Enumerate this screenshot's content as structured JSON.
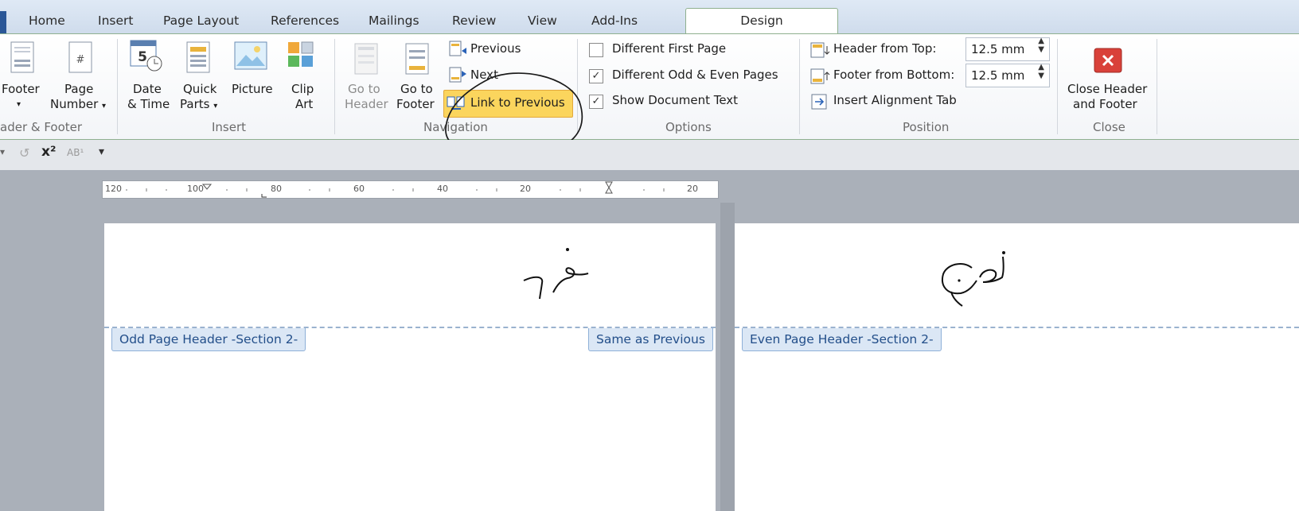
{
  "tabs": [
    "Home",
    "Insert",
    "Page Layout",
    "References",
    "Mailings",
    "Review",
    "View",
    "Add-Ins",
    "Design"
  ],
  "ribbon": {
    "header_footer": {
      "footer": "Footer",
      "page": "Page",
      "number": "Number",
      "group": "ader & Footer"
    },
    "insert": {
      "date": "Date",
      "time": "& Time",
      "quick": "Quick",
      "parts": "Parts",
      "picture": "Picture",
      "clip": "Clip",
      "art": "Art",
      "group": "Insert"
    },
    "navigation": {
      "goto1": "Go to",
      "header": "Header",
      "goto2": "Go to",
      "footer": "Footer",
      "previous": "Previous",
      "next": "Next",
      "link_to_previous": "Link to Previous",
      "group": "Navigation"
    },
    "options": {
      "different_first_page": "Different First Page",
      "different_odd_even": "Different Odd & Even Pages",
      "show_document_text": "Show Document Text",
      "group": "Options",
      "first_checked": false,
      "odd_even_checked": true,
      "show_text_checked": true
    },
    "position": {
      "header_from_top": "Header from Top:",
      "footer_from_bottom": "Footer from Bottom:",
      "header_value": "12.5 mm",
      "footer_value": "12.5 mm",
      "insert_alignment_tab": "Insert Alignment Tab",
      "group": "Position"
    },
    "close": {
      "close1": "Close Header",
      "close2": "and Footer",
      "group": "Close"
    }
  },
  "ruler": {
    "ticks": [
      "120",
      "100",
      "80",
      "60",
      "40",
      "20",
      "20"
    ]
  },
  "pages": {
    "odd_label": "Odd Page Header -Section 2-",
    "same_as_previous": "Same as Previous",
    "even_label": "Even Page Header -Section 2-"
  },
  "colors": {
    "ribbon_border": "#8fb08f",
    "highlight": "#fbd55d",
    "header_label_bg": "#dbe7f5",
    "word_blue": "#2b5797"
  }
}
